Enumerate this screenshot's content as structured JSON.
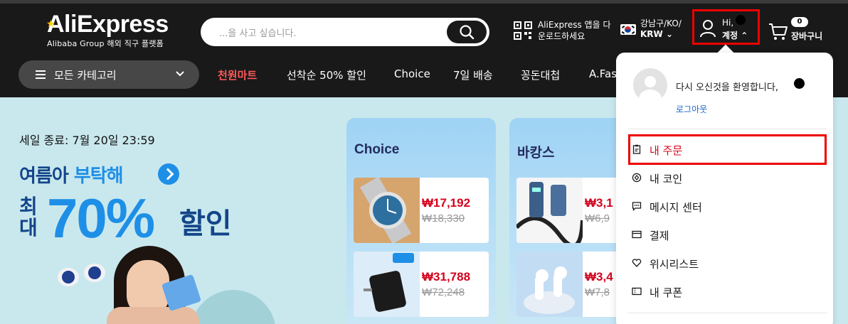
{
  "header": {
    "logo": {
      "name": "AliExpress",
      "tagline": "Alibaba Group 해외 직구 플랫폼"
    },
    "search": {
      "placeholder": "...을 사고 싶습니다."
    },
    "app_download": {
      "line1": "AliExpress 앱을 다",
      "line2": "운로드하세요"
    },
    "region": {
      "location": "강남구/KO/",
      "currency": "KRW"
    },
    "account": {
      "greeting": "Hi,",
      "label": "계정"
    },
    "cart": {
      "count": "0",
      "label": "장바구니"
    }
  },
  "nav": {
    "categories_label": "모든 카테고리",
    "items": [
      "천원마트",
      "선착순 50% 할인",
      "Choice",
      "7일 배송",
      "꽁돈대첩",
      "A.Fas"
    ]
  },
  "banner": {
    "sale_end": "세일 종료: 7월 20일 23:59",
    "line1_a": "여름아",
    "line1_b": "부탁해",
    "max": "최대",
    "percent": "70%",
    "sale": "할인"
  },
  "cards": [
    {
      "title": "Choice",
      "products": [
        {
          "price": "₩17,192",
          "old_price": "₩18,330",
          "image": "watch"
        },
        {
          "price": "₩31,788",
          "old_price": "₩72,248",
          "image": "charger"
        }
      ]
    },
    {
      "title": "바캉스",
      "products": [
        {
          "price": "₩3,1",
          "old_price": "₩6,9",
          "image": "usb-cable"
        },
        {
          "price": "₩3,4",
          "old_price": "₩7,8",
          "image": "earbuds"
        }
      ]
    }
  ],
  "account_menu": {
    "welcome": "다시 오신것을 환영합니다,",
    "logout": "로그아웃",
    "items": [
      {
        "label": "내 주문",
        "icon": "order-icon"
      },
      {
        "label": "내 코인",
        "icon": "coin-icon"
      },
      {
        "label": "메시지 센터",
        "icon": "message-icon"
      },
      {
        "label": "결제",
        "icon": "payment-icon"
      },
      {
        "label": "위시리스트",
        "icon": "heart-icon"
      },
      {
        "label": "내 쿠폰",
        "icon": "coupon-icon"
      }
    ]
  },
  "colors": {
    "header_bg": "#191919",
    "accent_red": "#d3031c",
    "hot_nav": "#ff5a5a",
    "link_blue": "#1b66c9",
    "banner_bg": "#c9e8ee"
  }
}
